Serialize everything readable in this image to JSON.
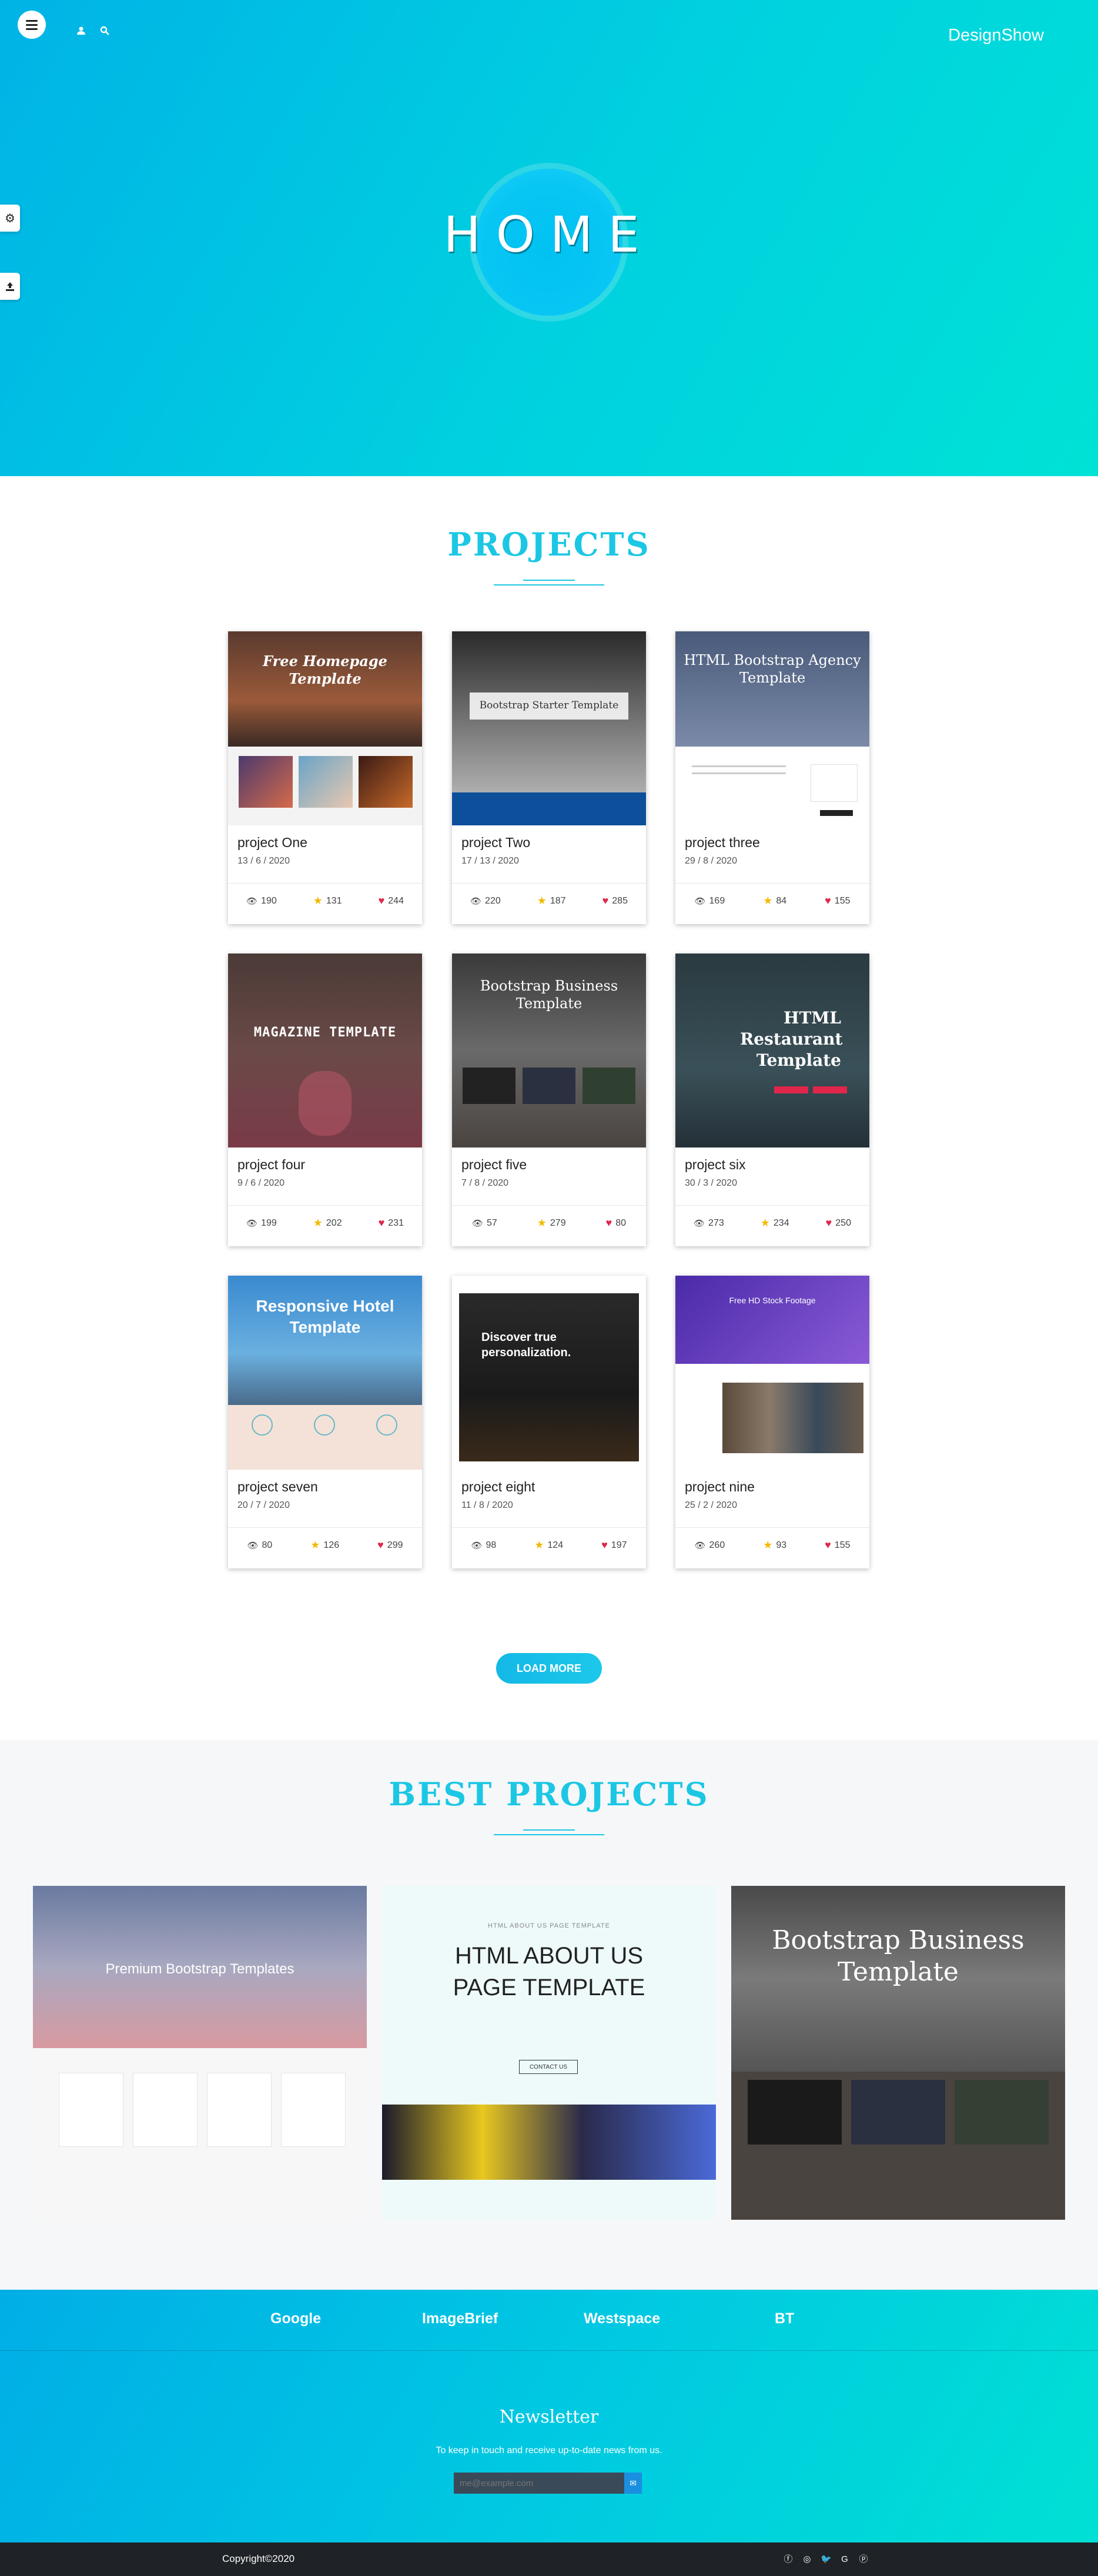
{
  "header": {
    "brand": "DesignShow",
    "menu_icon": "hamburger-icon",
    "user_icon": "user-icon",
    "search_icon": "search-icon"
  },
  "sidebar": {
    "settings_icon": "gear-icon",
    "upload_icon": "upload-icon"
  },
  "hero": {
    "title": "HOME"
  },
  "projects": {
    "title": "PROJECTS",
    "load_more": "LOAD MORE",
    "items": [
      {
        "name": "project One",
        "date": "13 / 6 / 2020",
        "views": "190",
        "stars": "131",
        "likes": "244",
        "thumb_title": "Free Homepage Template"
      },
      {
        "name": "project Two",
        "date": "17 / 13 / 2020",
        "views": "220",
        "stars": "187",
        "likes": "285",
        "thumb_title": "Bootstrap Starter Template"
      },
      {
        "name": "project three",
        "date": "29 / 8 / 2020",
        "views": "169",
        "stars": "84",
        "likes": "155",
        "thumb_title": "HTML Bootstrap Agency Template"
      },
      {
        "name": "project four",
        "date": "9 / 6 / 2020",
        "views": "199",
        "stars": "202",
        "likes": "231",
        "thumb_title": "MAGAZINE TEMPLATE"
      },
      {
        "name": "project five",
        "date": "7 / 8 / 2020",
        "views": "57",
        "stars": "279",
        "likes": "80",
        "thumb_title": "Bootstrap Business Template"
      },
      {
        "name": "project six",
        "date": "30 / 3 / 2020",
        "views": "273",
        "stars": "234",
        "likes": "250",
        "thumb_title": "HTML Restaurant Template"
      },
      {
        "name": "project seven",
        "date": "20 / 7 / 2020",
        "views": "80",
        "stars": "126",
        "likes": "299",
        "thumb_title": "Responsive Hotel Template"
      },
      {
        "name": "project eight",
        "date": "11 / 8 / 2020",
        "views": "98",
        "stars": "124",
        "likes": "197",
        "thumb_title": "Discover true personalization."
      },
      {
        "name": "project nine",
        "date": "25 / 2 / 2020",
        "views": "260",
        "stars": "93",
        "likes": "155",
        "thumb_title": "Free HD Stock Footage"
      }
    ]
  },
  "best_projects": {
    "title": "BEST PROJECTS",
    "items": [
      {
        "title": "Premium Bootstrap Templates"
      },
      {
        "kicker": "HTML ABOUT US PAGE TEMPLATE",
        "title": "HTML ABOUT US PAGE TEMPLATE",
        "button": "CONTACT US"
      },
      {
        "title": "Bootstrap Business Template"
      }
    ]
  },
  "partners": [
    "Google",
    "ImageBrief",
    "Westspace",
    "BT"
  ],
  "newsletter": {
    "title": "Newsletter",
    "text": "To keep in touch and receive up-to-date news from us.",
    "placeholder": "me@example.com"
  },
  "footer": {
    "copyright": "Copyright©2020",
    "social_icons": [
      "facebook-icon",
      "instagram-icon",
      "twitter-icon",
      "google-icon",
      "pinterest-icon"
    ]
  },
  "colors": {
    "accent": "#1cc7e4",
    "star": "#f5b800",
    "heart": "#e0264a",
    "footer_bar": "#1f2226"
  }
}
